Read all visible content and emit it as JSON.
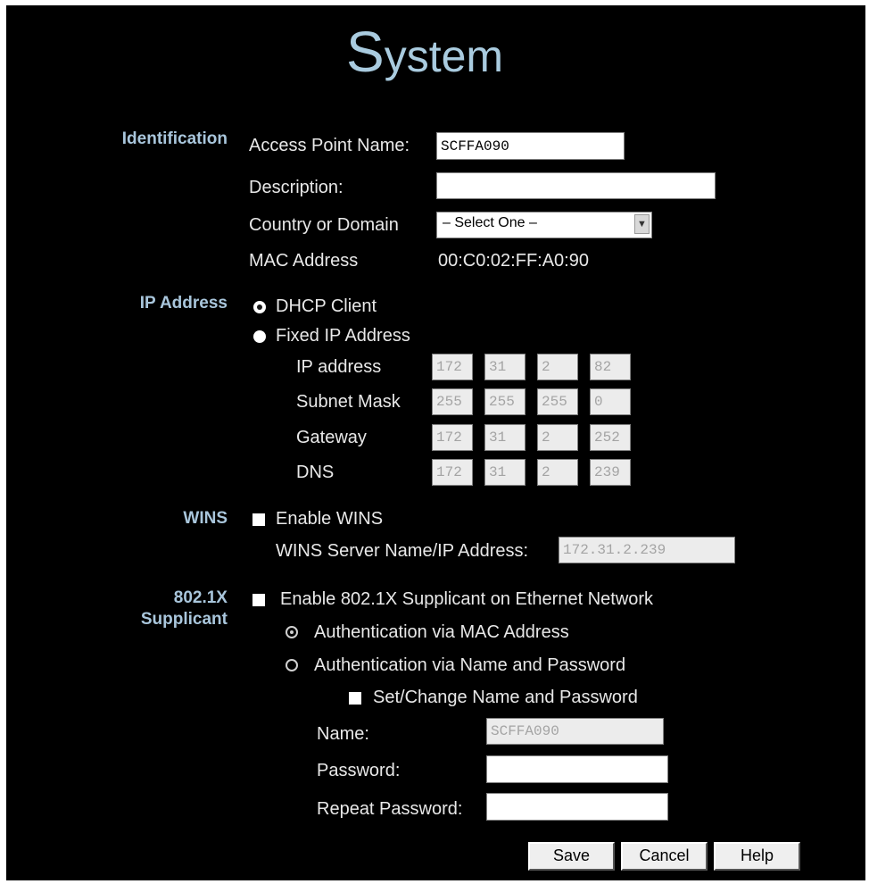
{
  "page": {
    "title_initial": "S",
    "title_rest": "ystem"
  },
  "identification": {
    "section_label": "Identification",
    "ap_name_label": "Access Point Name:",
    "ap_name_value": "SCFFA090",
    "description_label": "Description:",
    "description_value": "",
    "country_label": "Country or Domain",
    "country_value": "– Select One –",
    "mac_label": "MAC Address",
    "mac_value": "00:C0:02:FF:A0:90"
  },
  "ip": {
    "section_label": "IP Address",
    "dhcp_label": "DHCP Client",
    "dhcp_selected": true,
    "fixed_label": "Fixed IP Address",
    "fixed_selected": false,
    "rows": [
      {
        "label": "IP address",
        "octets": [
          "172",
          "31",
          "2",
          "82"
        ]
      },
      {
        "label": "Subnet Mask",
        "octets": [
          "255",
          "255",
          "255",
          "0"
        ]
      },
      {
        "label": "Gateway",
        "octets": [
          "172",
          "31",
          "2",
          "252"
        ]
      },
      {
        "label": "DNS",
        "octets": [
          "172",
          "31",
          "2",
          "239"
        ]
      }
    ]
  },
  "wins": {
    "section_label": "WINS",
    "enable_label": "Enable WINS",
    "enabled": false,
    "server_label": "WINS Server Name/IP Address:",
    "server_value": "172.31.2.239"
  },
  "supplicant": {
    "section_label_1": "802.1X",
    "section_label_2": "Supplicant",
    "enable_label": "Enable 802.1X Supplicant on Ethernet Network",
    "enabled": false,
    "auth_mac_label": "Authentication via MAC Address",
    "auth_mac_selected": true,
    "auth_name_label": "Authentication via Name and Password",
    "auth_name_selected": false,
    "set_change_label": "Set/Change Name and Password",
    "set_change_checked": false,
    "name_label": "Name:",
    "name_value": "SCFFA090",
    "password_label": "Password:",
    "password_value": "",
    "repeat_label": "Repeat Password:",
    "repeat_value": ""
  },
  "buttons": {
    "save": "Save",
    "cancel": "Cancel",
    "help": "Help"
  },
  "colors": {
    "background": "#000000",
    "section_label": "#a9c6dc",
    "text": "#e8e8e8"
  }
}
